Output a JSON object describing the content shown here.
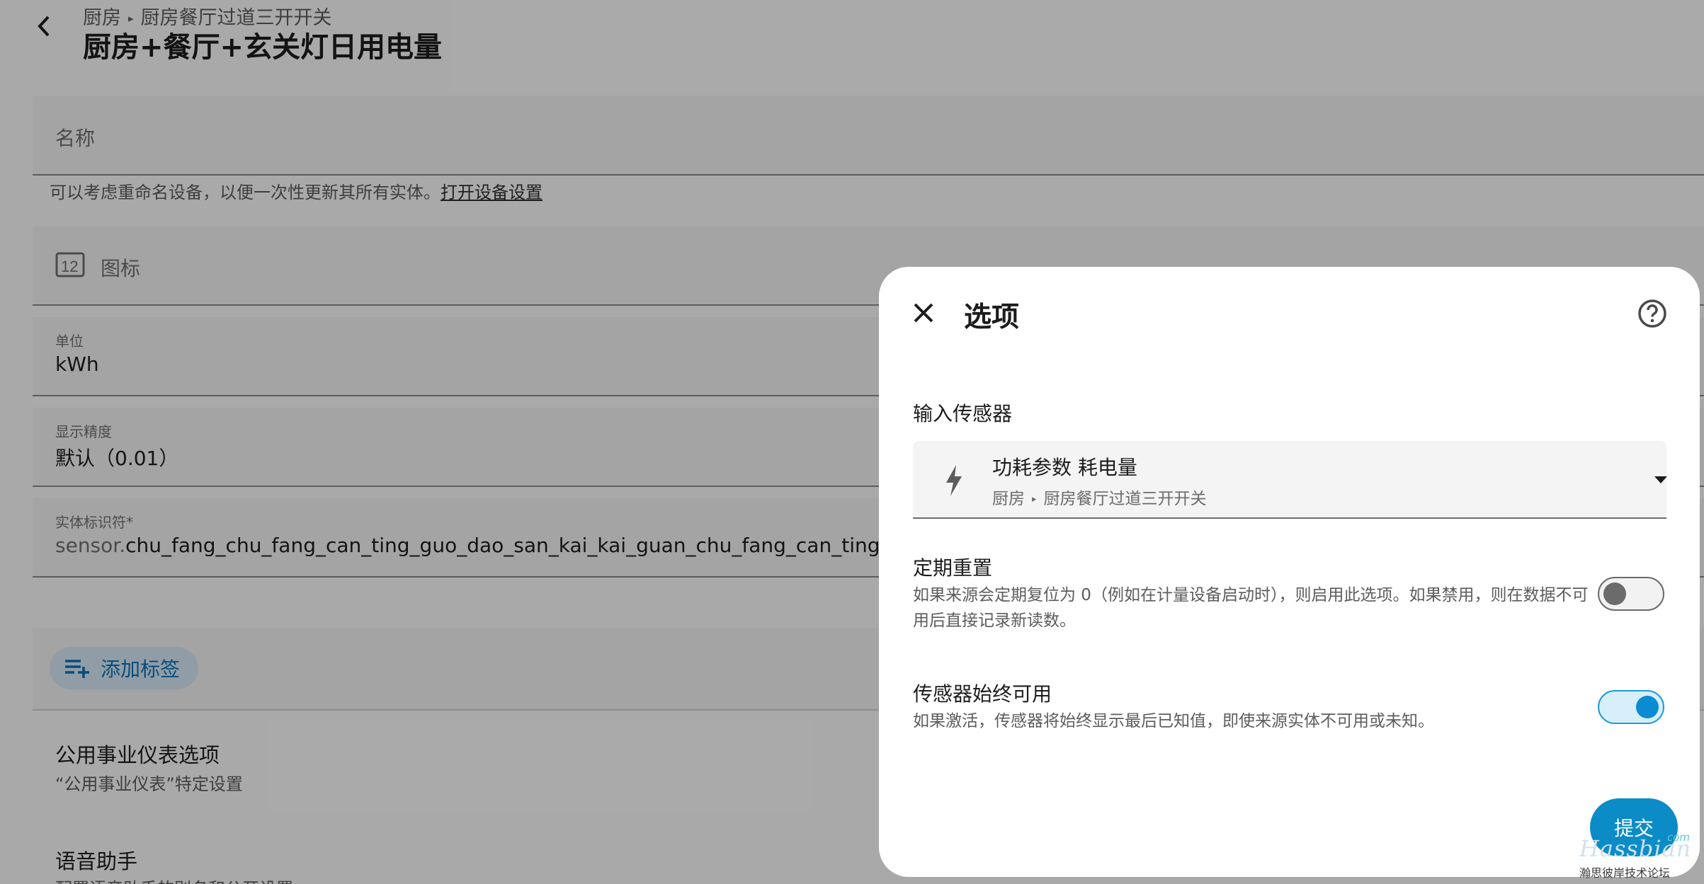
{
  "header": {
    "breadcrumb": [
      "厨房",
      "厨房餐厅过道三开开关"
    ],
    "title": "厨房+餐厅+玄关灯日用电量"
  },
  "form": {
    "name_label": "名称",
    "helper_text": "可以考虑重命名设备，以便一次性更新其所有实体。",
    "helper_link": "打开设备设置",
    "icon_label": "图标",
    "unit_label": "单位",
    "unit_value": "kWh",
    "precision_label": "显示精度",
    "precision_value": "默认（0.01）",
    "entity_id_label": "实体标识符*",
    "entity_id_prefix": "sensor.",
    "entity_id_value": "chu_fang_chu_fang_can_ting_guo_dao_san_kai_kai_guan_chu_fang_can_ting_xuan_gua",
    "add_tag_label": "添加标签",
    "utility_title": "公用事业仪表选项",
    "utility_sub": "“公用事业仪表”特定设置",
    "voice_title": "语音助手",
    "voice_sub": "配置语音助手的别名和公开设置"
  },
  "dialog": {
    "title": "选项",
    "input_sensor_label": "输入传感器",
    "sensor_name": "功耗参数 耗电量",
    "sensor_context": [
      "厨房",
      "厨房餐厅过道三开开关"
    ],
    "periodic_reset_title": "定期重置",
    "periodic_reset_desc": "如果来源会定期复位为 0（例如在计量设备启动时），则启用此选项。如果禁用，则在数据不可用后直接记录新读数。",
    "periodic_reset_on": false,
    "always_available_title": "传感器始终可用",
    "always_available_desc": "如果激活，传感器将始终显示最后已知值，即使来源实体不可用或未知。",
    "always_available_on": true,
    "submit_label": "提交"
  },
  "watermark": {
    "brand": "Hassbian",
    "com": "com",
    "sub": "瀚思彼岸技术论坛"
  },
  "colors": {
    "accent": "#0b8cc6",
    "switch_on": "#0b8cd2",
    "scrim": "rgba(0,0,0,0.32)"
  },
  "icons": [
    "back-arrow-icon",
    "counter-icon",
    "playlist-plus-icon",
    "close-icon",
    "help-circle-icon",
    "flash-icon",
    "menu-down-icon"
  ]
}
